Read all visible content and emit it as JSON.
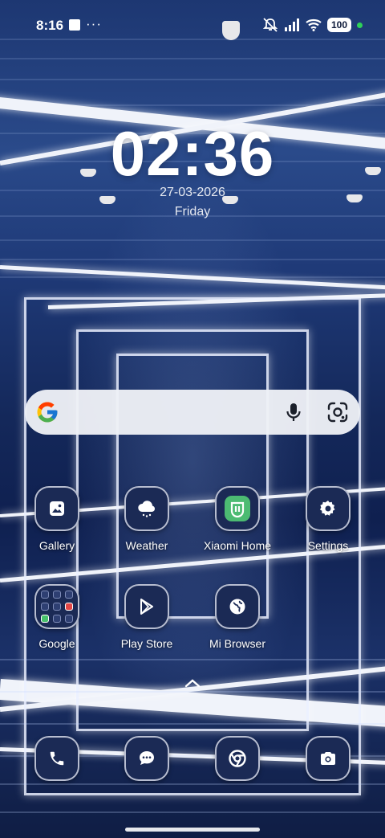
{
  "status_bar": {
    "time": "8:16",
    "more": "···",
    "battery": "100",
    "icons": [
      "notification-square-icon",
      "more-dots-icon",
      "smoke-detector-icon",
      "silent-mode-icon",
      "signal-icon",
      "wifi-icon",
      "battery-icon",
      "privacy-dot-icon"
    ]
  },
  "clock": {
    "time": "02:36",
    "date": "27-03-2026",
    "day": "Friday"
  },
  "search": {
    "icons": [
      "google-logo-icon",
      "microphone-icon",
      "google-lens-icon"
    ]
  },
  "apps": {
    "gallery": "Gallery",
    "weather": "Weather",
    "xiaomi_home": "Xiaomi Home",
    "settings": "Settings",
    "google": "Google",
    "play_store": "Play Store",
    "mi_browser": "Mi Browser"
  },
  "dock": {
    "icons": [
      "phone-icon",
      "messages-icon",
      "chrome-icon",
      "camera-icon"
    ]
  },
  "colors": {
    "icon_background": "#1b2a55",
    "xiaomi_green": "#4cbb72",
    "search_background": "#eef0f6"
  }
}
